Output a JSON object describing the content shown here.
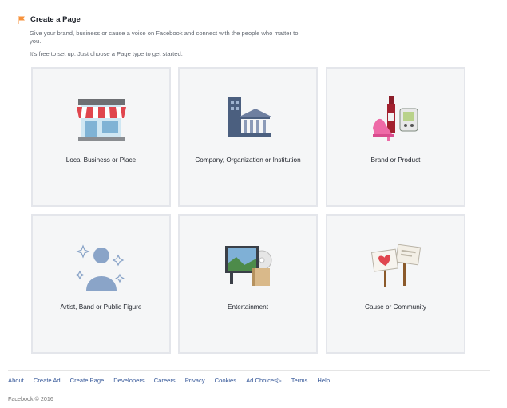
{
  "header": {
    "title": "Create a Page",
    "description": "Give your brand, business or cause a voice on Facebook and connect with the people who matter to you.",
    "subtext": "It's free to set up. Just choose a Page type to get started."
  },
  "tiles": [
    {
      "label": "Local Business or Place",
      "icon": "storefront-icon"
    },
    {
      "label": "Company, Organization or Institution",
      "icon": "buildings-icon"
    },
    {
      "label": "Brand or Product",
      "icon": "products-icon"
    },
    {
      "label": "Artist, Band or Public Figure",
      "icon": "person-sparkles-icon"
    },
    {
      "label": "Entertainment",
      "icon": "tv-media-icon"
    },
    {
      "label": "Cause or Community",
      "icon": "protest-signs-icon"
    }
  ],
  "footer": {
    "links": [
      "About",
      "Create Ad",
      "Create Page",
      "Developers",
      "Careers",
      "Privacy",
      "Cookies",
      "Ad Choices▷",
      "Terms",
      "Help"
    ],
    "copyright": "Facebook © 2016"
  },
  "colors": {
    "link": "#365899",
    "tile_bg": "#f5f6f7",
    "tile_border": "#e4e6eb",
    "accent": "#f7923b"
  }
}
